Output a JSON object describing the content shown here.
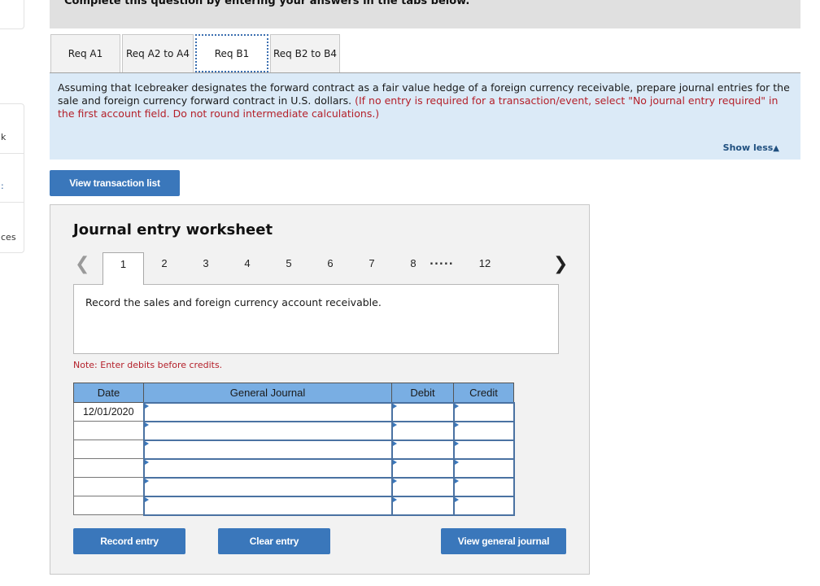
{
  "sidebar": {
    "items": [
      {
        "label": "k"
      },
      {
        "label": ":"
      },
      {
        "label": "ces"
      }
    ]
  },
  "header": {
    "title": "Complete this question by entering your answers in the tabs below."
  },
  "tabs": [
    {
      "label": "Req A1",
      "active": false
    },
    {
      "label": "Req A2 to A4",
      "active": false
    },
    {
      "label": "Req B1",
      "active": true
    },
    {
      "label": "Req B2 to B4",
      "active": false
    }
  ],
  "instructions": {
    "text": "Assuming that Icebreaker designates the forward contract as a fair value hedge of a foreign currency receivable, prepare journal entries for the sale and foreign currency forward contract in U.S. dollars.",
    "note": "(If no entry is required for a transaction/event, select \"No journal entry required\" in the first account field. Do not round intermediate calculations.)",
    "show_less": "Show less",
    "show_less_icon": "triangle-up-icon"
  },
  "buttons": {
    "view_transaction_list": "View transaction list",
    "record_entry": "Record entry",
    "clear_entry": "Clear entry",
    "view_general_journal": "View general journal"
  },
  "worksheet": {
    "title": "Journal entry worksheet",
    "pager": {
      "prev_icon": "chevron-left-icon",
      "next_icon": "chevron-right-icon",
      "pages": [
        "1",
        "2",
        "3",
        "4",
        "5",
        "6",
        "7",
        "8"
      ],
      "ellipsis": ".....",
      "last_page": "12",
      "current": "1"
    },
    "description": "Record the sales and foreign currency account receivable.",
    "note": "Note: Enter debits before credits.",
    "table": {
      "headers": {
        "date": "Date",
        "general_journal": "General Journal",
        "debit": "Debit",
        "credit": "Credit"
      },
      "rows": [
        {
          "date": "12/01/2020",
          "account": "",
          "debit": "",
          "credit": ""
        },
        {
          "date": "",
          "account": "",
          "debit": "",
          "credit": ""
        },
        {
          "date": "",
          "account": "",
          "debit": "",
          "credit": ""
        },
        {
          "date": "",
          "account": "",
          "debit": "",
          "credit": ""
        },
        {
          "date": "",
          "account": "",
          "debit": "",
          "credit": ""
        },
        {
          "date": "",
          "account": "",
          "debit": "",
          "credit": ""
        }
      ]
    }
  }
}
